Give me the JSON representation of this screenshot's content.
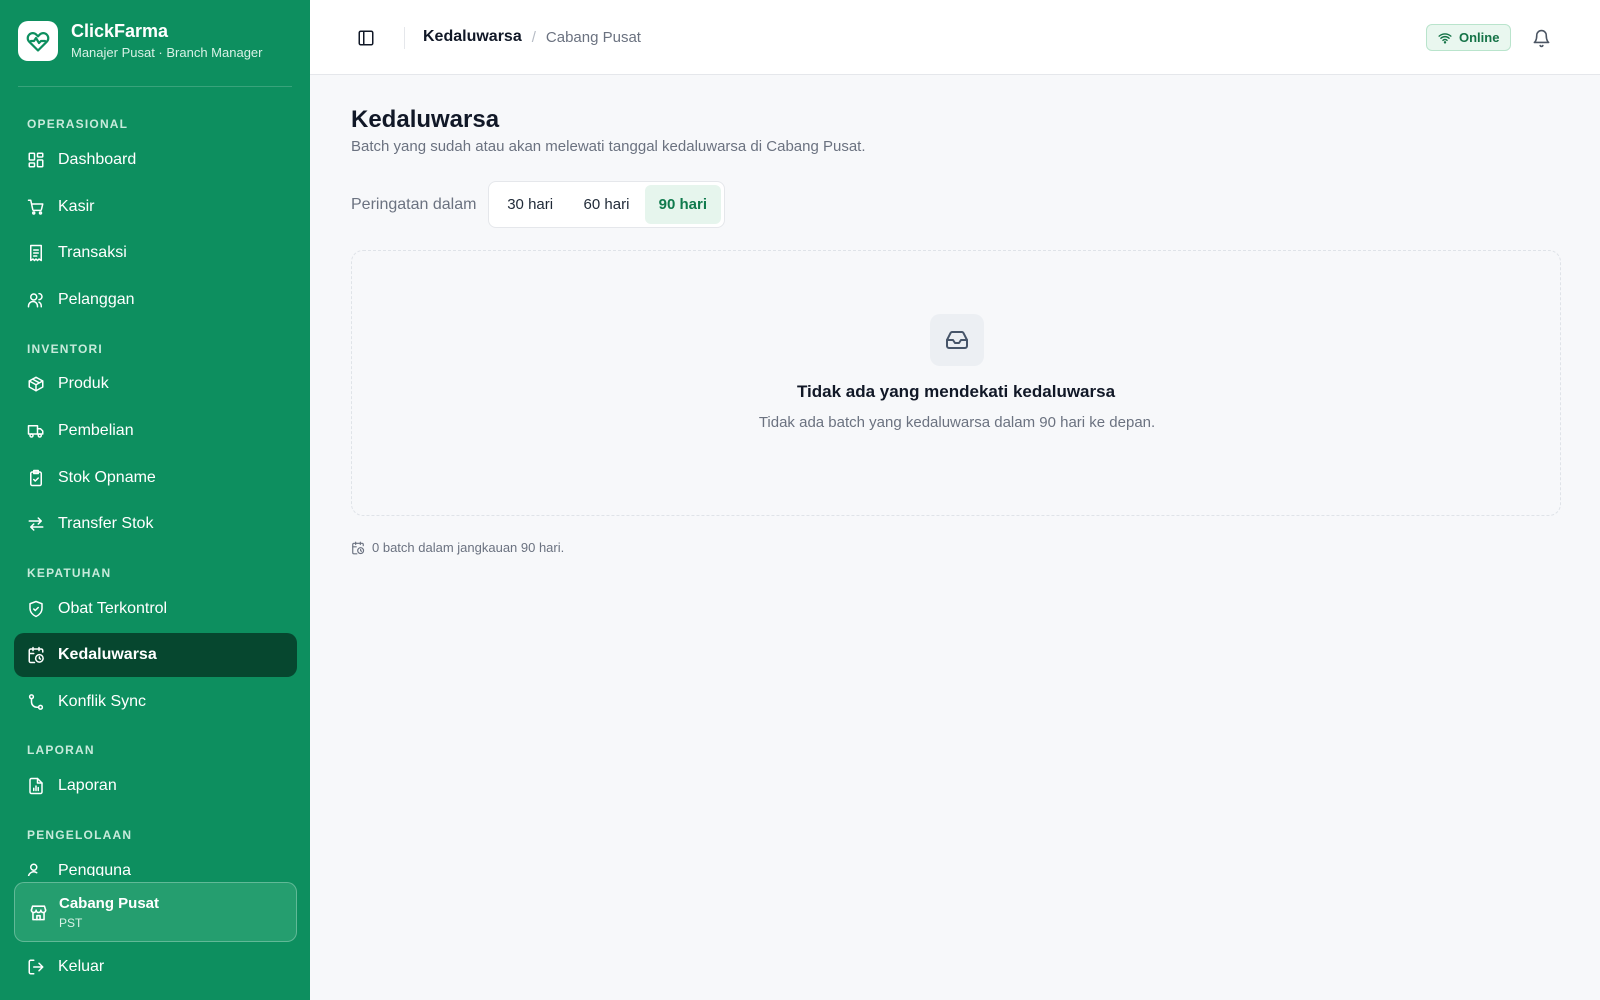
{
  "brand": {
    "name": "ClickFarma",
    "subtitle": "Manajer Pusat · Branch Manager"
  },
  "sidebar": {
    "sections": {
      "operasional": "OPERASIONAL",
      "inventori": "INVENTORI",
      "kepatuhan": "KEPATUHAN",
      "laporan": "LAPORAN",
      "pengelolaan": "PENGELOLAAN"
    },
    "items": {
      "dashboard": "Dashboard",
      "kasir": "Kasir",
      "transaksi": "Transaksi",
      "pelanggan": "Pelanggan",
      "produk": "Produk",
      "pembelian": "Pembelian",
      "stok_opname": "Stok Opname",
      "transfer_stok": "Transfer Stok",
      "obat_terkontrol": "Obat Terkontrol",
      "kedaluwarsa": "Kedaluwarsa",
      "konflik_sync": "Konflik Sync",
      "laporan": "Laporan",
      "pengguna": "Pengguna"
    },
    "branch": {
      "name": "Cabang Pusat",
      "code": "PST"
    },
    "logout": "Keluar"
  },
  "topbar": {
    "breadcrumb_current": "Kedaluwarsa",
    "breadcrumb_parent": "Cabang Pusat",
    "status": "Online"
  },
  "page": {
    "title": "Kedaluwarsa",
    "description": "Batch yang sudah atau akan melewati tanggal kedaluwarsa di Cabang Pusat.",
    "filter_label": "Peringatan dalam",
    "filters": [
      "30 hari",
      "60 hari",
      "90 hari"
    ],
    "selected_filter": "90 hari",
    "empty_title": "Tidak ada yang mendekati kedaluwarsa",
    "empty_desc": "Tidak ada batch yang kedaluwarsa dalam 90 hari ke depan.",
    "footnote": "0 batch dalam jangkauan 90 hari."
  },
  "colors": {
    "sidebar": "#0d8f5f",
    "sidebar_active": "#06472f",
    "accent": "#0f7a4d",
    "online": "#157347"
  }
}
